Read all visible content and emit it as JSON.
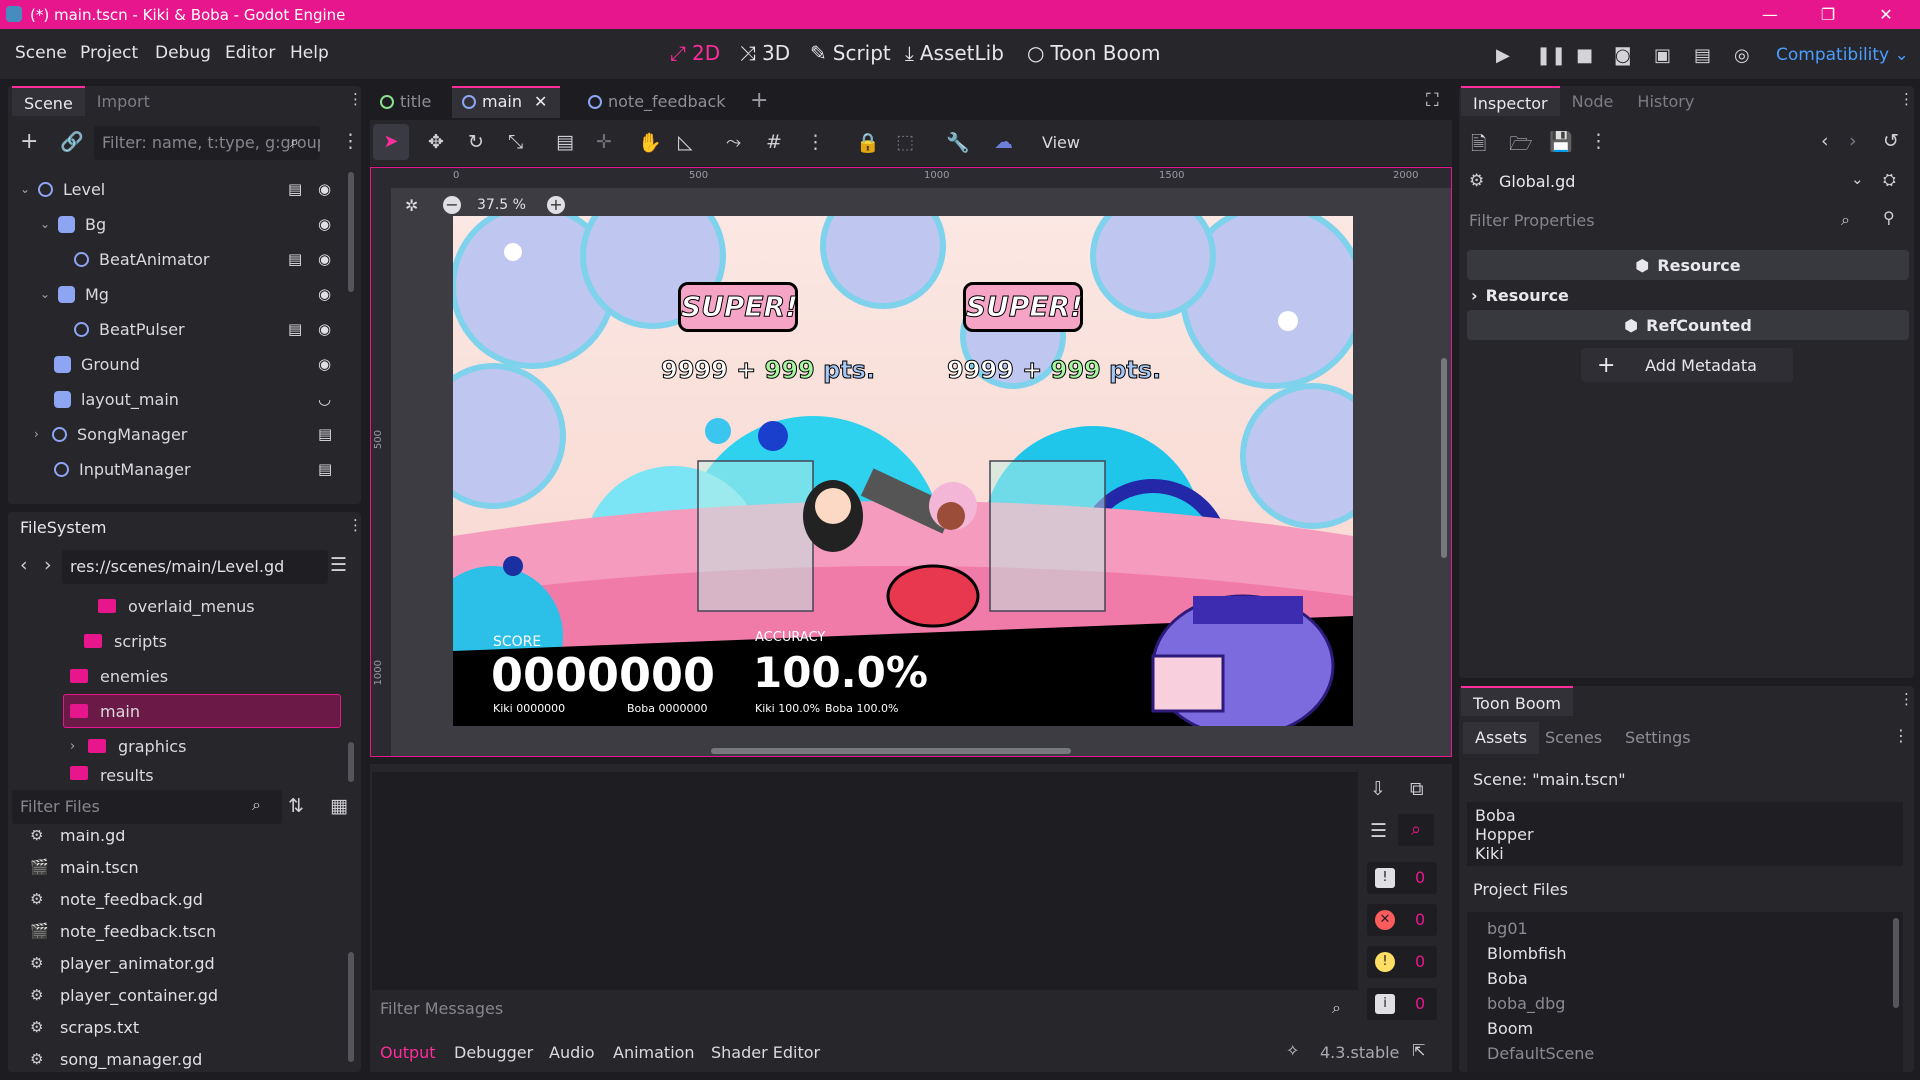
{
  "window": {
    "title": "(*) main.tscn - Kiki & Boba - Godot Engine"
  },
  "menu": [
    "Scene",
    "Project",
    "Debug",
    "Editor",
    "Help"
  ],
  "workspaces": [
    {
      "label": "2D"
    },
    {
      "label": "3D"
    },
    {
      "label": "Script"
    },
    {
      "label": "AssetLib"
    },
    {
      "label": "Toon Boom"
    }
  ],
  "renderer": "Compatibility",
  "scene_panel": {
    "tabs": [
      "Scene",
      "Import"
    ],
    "filter_placeholder": "Filter: name, t:type, g:group",
    "nodes": [
      {
        "name": "Level"
      },
      {
        "name": "Bg"
      },
      {
        "name": "BeatAnimator"
      },
      {
        "name": "Mg"
      },
      {
        "name": "BeatPulser"
      },
      {
        "name": "Ground"
      },
      {
        "name": "layout_main"
      },
      {
        "name": "SongManager"
      },
      {
        "name": "InputManager"
      }
    ]
  },
  "filesystem": {
    "title": "FileSystem",
    "path": "res://scenes/main/Level.gd",
    "folders": [
      "overlaid_menus",
      "scripts",
      "enemies",
      "main",
      "graphics",
      "results"
    ],
    "filter_placeholder": "Filter Files",
    "files": [
      "main.gd",
      "main.tscn",
      "note_feedback.gd",
      "note_feedback.tscn",
      "player_animator.gd",
      "player_container.gd",
      "scraps.txt",
      "song_manager.gd"
    ]
  },
  "editor_tabs": [
    "title",
    "main",
    "note_feedback"
  ],
  "viewport": {
    "view_label": "View",
    "zoom": "37.5 %",
    "ruler": [
      "0",
      "500",
      "1000",
      "1500",
      "2000"
    ],
    "vruler": [
      "500",
      "1000"
    ],
    "game": {
      "banner": "SUPER!",
      "pts_a": "9999",
      "pts_plus": "+",
      "pts_b": "999",
      "pts_unit": "pts.",
      "score_label": "SCORE",
      "score": "0000000",
      "score_sub_a": "Kiki 0000000",
      "score_sub_b": "Boba 0000000",
      "acc_label": "ACCURACY",
      "accuracy": "100.0%",
      "acc_sub_a": "Kiki 100.0%",
      "acc_sub_b": "Boba 100.0%"
    }
  },
  "output": {
    "filter_placeholder": "Filter Messages",
    "counts": [
      "0",
      "0",
      "0",
      "0"
    ],
    "tabs": [
      "Output",
      "Debugger",
      "Audio",
      "Animation",
      "Shader Editor"
    ],
    "version": "4.3.stable"
  },
  "inspector": {
    "tabs": [
      "Inspector",
      "Node",
      "History"
    ],
    "resource": "Global.gd",
    "filter_placeholder": "Filter Properties",
    "sections": {
      "resource_btn": "Resource",
      "resource_cat": "Resource",
      "refcounted": "RefCounted",
      "add_meta": "Add Metadata"
    }
  },
  "toonboom": {
    "title": "Toon Boom",
    "tabs": [
      "Assets",
      "Scenes",
      "Settings"
    ],
    "scene_label": "Scene: \"main.tscn\"",
    "assets": [
      "Boba",
      "Hopper",
      "Kiki"
    ],
    "project_files_label": "Project Files",
    "project_files": [
      "bg01",
      "Blombfish",
      "Boba",
      "boba_dbg",
      "Boom",
      "DefaultScene"
    ]
  },
  "colors": {
    "accent": "#e8168c",
    "panel": "#26262b",
    "bg": "#1d1d21",
    "blue": "#4a9eff"
  }
}
